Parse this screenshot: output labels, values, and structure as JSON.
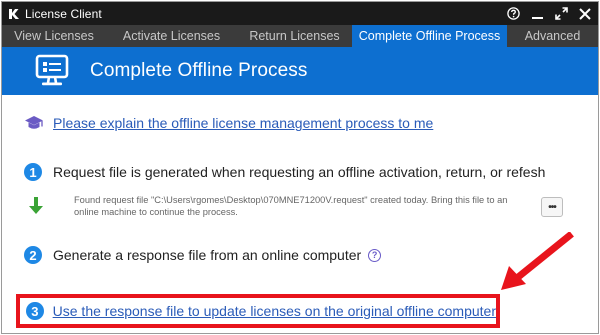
{
  "window": {
    "title": "License Client",
    "controls": [
      "help-icon",
      "minimize-icon",
      "maximize-icon",
      "close-icon"
    ]
  },
  "tabs": [
    {
      "label": "View Licenses",
      "active": false
    },
    {
      "label": "Activate Licenses",
      "active": false
    },
    {
      "label": "Return Licenses",
      "active": false
    },
    {
      "label": "Complete Offline Process",
      "active": true
    },
    {
      "label": "Advanced",
      "active": false
    }
  ],
  "header": {
    "title": "Complete Offline Process",
    "icon": "monitor-icon"
  },
  "help_link": {
    "label": "Please explain the offline license management process to me",
    "icon": "graduation-cap-icon"
  },
  "steps": {
    "step1": {
      "number": "1",
      "text": "Request file is generated when requesting an offline activation, return, or refesh",
      "request_info": "Found request file \"C:\\Users\\rgomes\\Desktop\\070MNE71200V.request\" created today. Bring this file to an online machine to continue the process.",
      "more_label": "•••"
    },
    "step2": {
      "number": "2",
      "text": "Generate a response file from an online computer",
      "info_label": "?"
    },
    "step3": {
      "number": "3",
      "link": "Use the response file to update licenses on the original offline computer"
    }
  },
  "colors": {
    "accent": "#0d6fd0",
    "titlebar": "#1a1a1a",
    "tabbar": "#3b3b3b",
    "link": "#2a5bb8",
    "highlight": "#e8141c",
    "step_circle": "#1e88e5",
    "download_arrow": "#3aa335"
  }
}
